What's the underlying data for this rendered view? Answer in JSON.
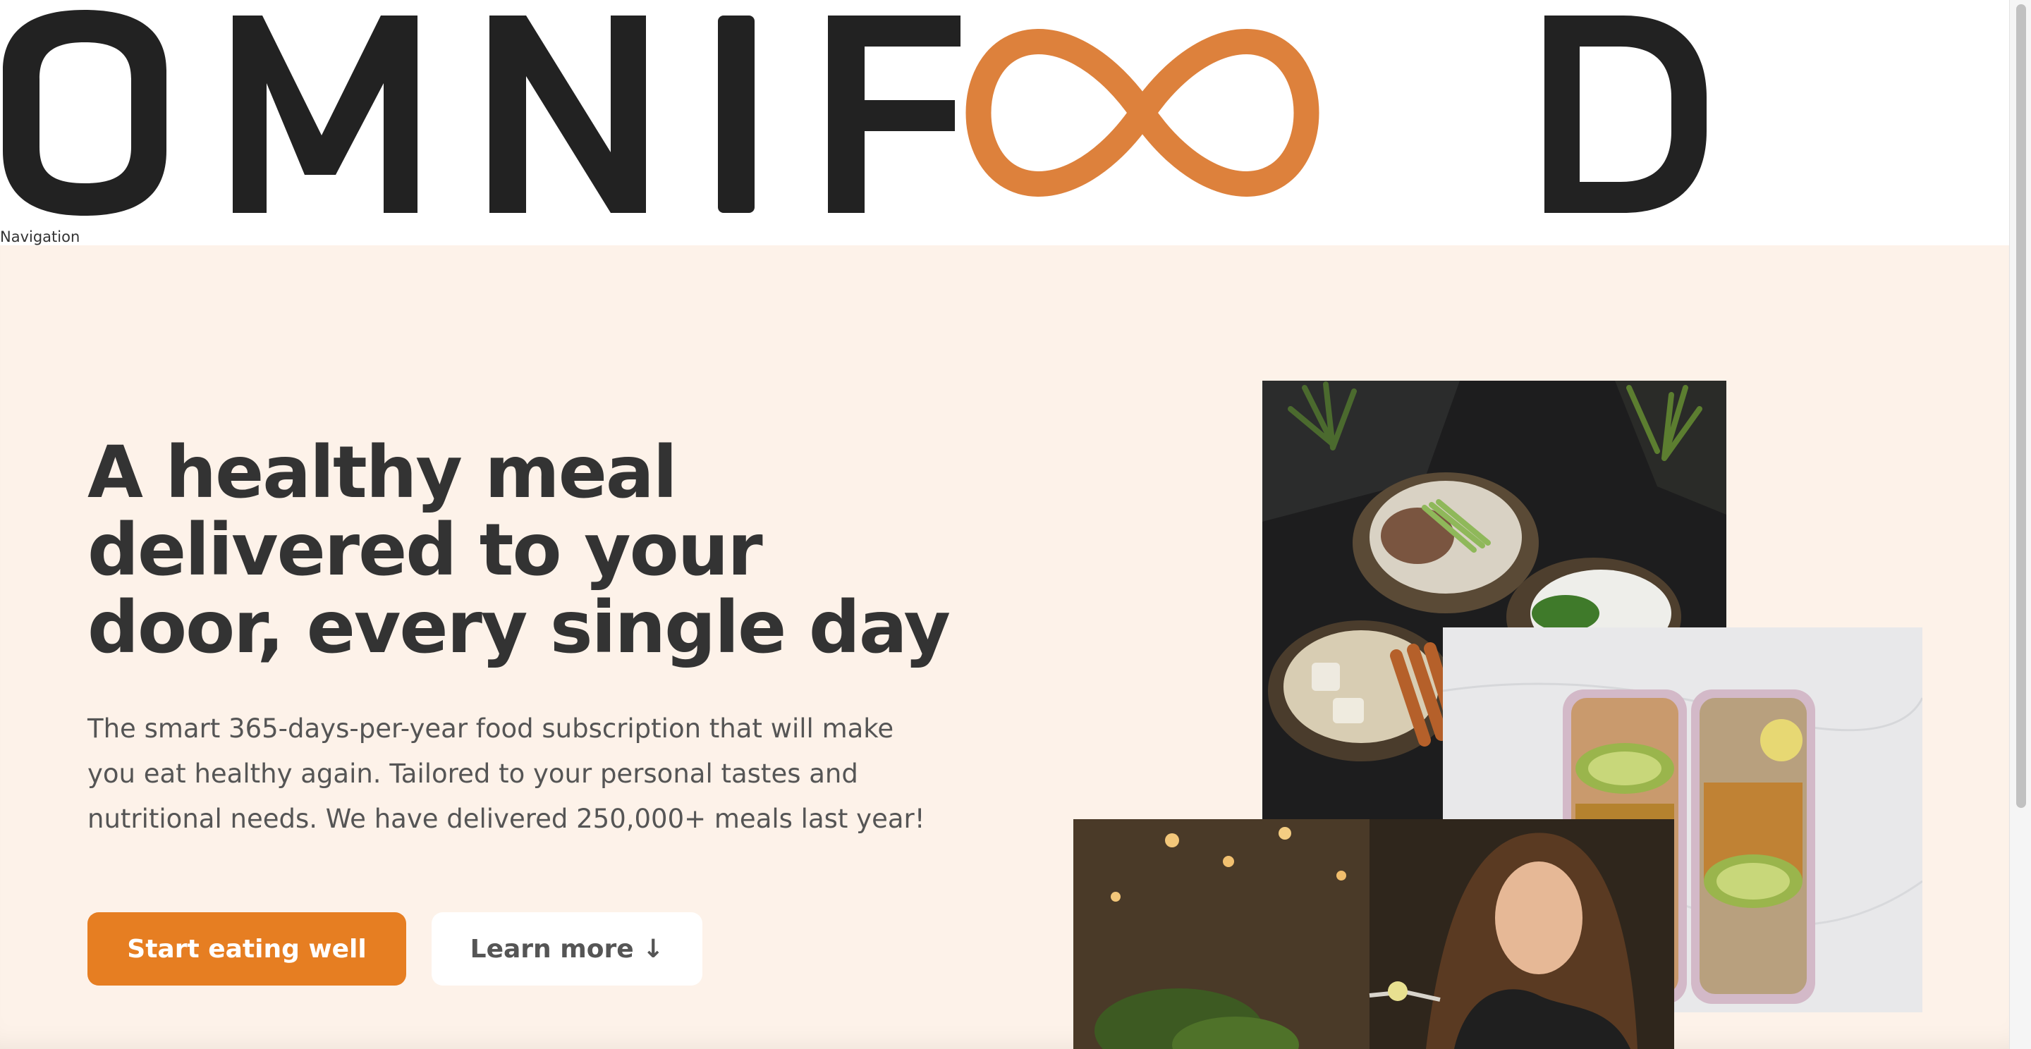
{
  "header": {
    "logo_text": "OMNIFOOD",
    "nav_label": "Navigation"
  },
  "hero": {
    "title": "A healthy meal delivered to your door, every single day",
    "description": "The smart 365-days-per-year food subscription that will make you eat healthy again. Tailored to your personal tastes and nutritional needs. We have delivered 250,000+ meals last year!",
    "primary_button": "Start eating well",
    "secondary_button": "Learn more ↓"
  },
  "images": [
    {
      "name": "food-bowls-photo"
    },
    {
      "name": "meal-prep-containers-photo"
    },
    {
      "name": "woman-eating-photo"
    }
  ],
  "colors": {
    "brand": "#e67e22",
    "text_dark": "#333333",
    "text_body": "#555555",
    "hero_background": "#fdf2e9"
  }
}
